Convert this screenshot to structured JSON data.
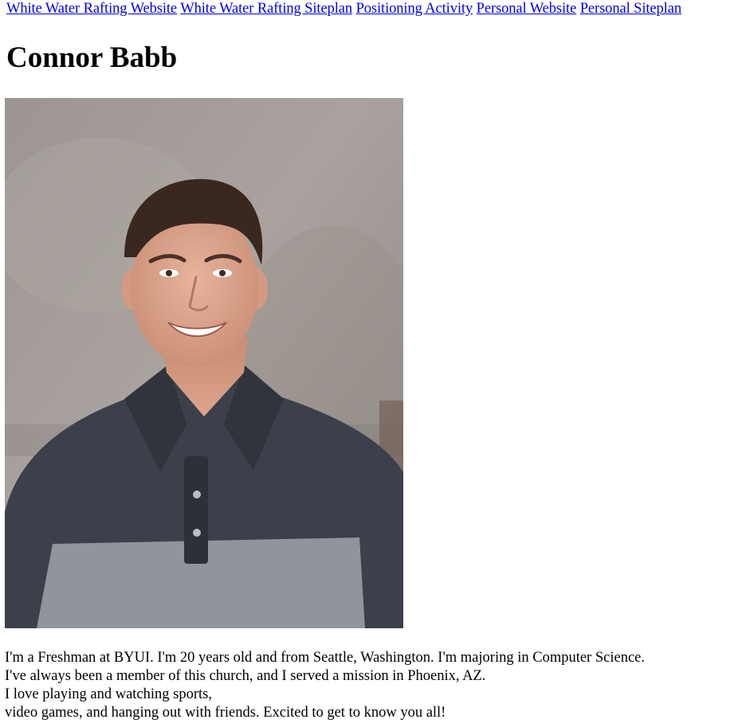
{
  "nav": {
    "links": [
      "White Water Rafting Website",
      "White Water Rafting Siteplan",
      "Positioning Activity",
      "Personal Website",
      "Personal Siteplan"
    ]
  },
  "header": {
    "title": "Connor Babb"
  },
  "bio": {
    "lines": [
      "I'm a Freshman at BYUI. I'm 20 years old and from Seattle, Washington. I'm majoring in Computer Science.",
      "I've always been a member of this church, and I served a mission in Phoenix, AZ.",
      "I love playing and watching sports,",
      "video games, and hanging out with friends. Excited to get to know you all!"
    ]
  },
  "colors": {
    "link": "#0000ee",
    "shirt_dark": "#3a3f49",
    "shirt_stripe": "#8e949a",
    "wall": "#a79f9b"
  }
}
